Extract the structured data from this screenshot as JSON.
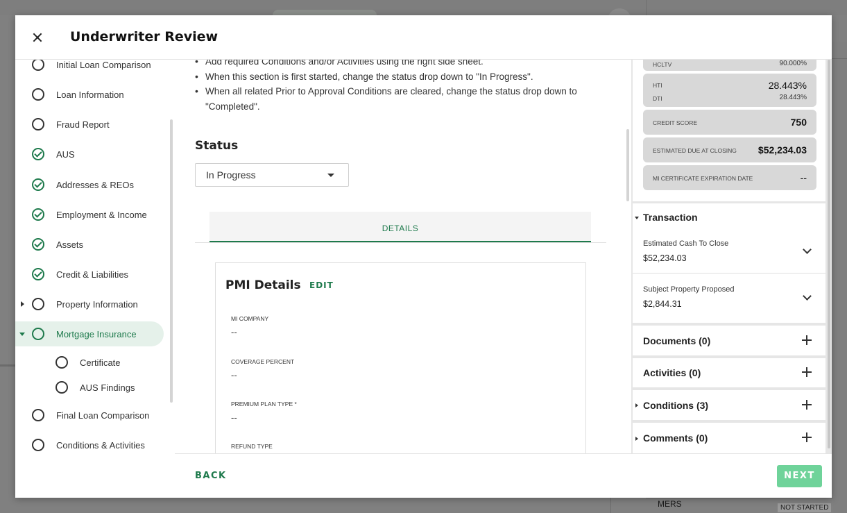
{
  "background": {
    "mers_label": "MERS",
    "not_started_badge": "NOT STARTED"
  },
  "modal": {
    "title": "Underwriter Review"
  },
  "nav": {
    "items": [
      {
        "label": "Initial Loan Comparison",
        "state": "empty"
      },
      {
        "label": "Loan Information",
        "state": "empty"
      },
      {
        "label": "Fraud Report",
        "state": "empty"
      },
      {
        "label": "AUS",
        "state": "complete"
      },
      {
        "label": "Addresses & REOs",
        "state": "complete"
      },
      {
        "label": "Employment & Income",
        "state": "complete"
      },
      {
        "label": "Assets",
        "state": "complete"
      },
      {
        "label": "Credit & Liabilities",
        "state": "complete"
      },
      {
        "label": "Property Information",
        "state": "empty"
      },
      {
        "label": "Mortgage Insurance",
        "state": "active"
      },
      {
        "label": "Certificate",
        "state": "empty"
      },
      {
        "label": "AUS Findings",
        "state": "empty"
      },
      {
        "label": "Final Loan Comparison",
        "state": "empty"
      },
      {
        "label": "Conditions & Activities",
        "state": "empty"
      }
    ]
  },
  "instructions": [
    "Add required Conditions and/or Activities using the right side sheet.",
    "When this section is first started, change the status drop down to \"In Progress\".",
    "When all related Prior to Approval Conditions are cleared, change the status drop down to \"Completed\"."
  ],
  "status": {
    "title": "Status",
    "value": "In Progress"
  },
  "tabs": {
    "details": "DETAILS"
  },
  "pmi": {
    "title": "PMI Details",
    "edit_label": "EDIT",
    "fields": [
      {
        "label": "MI COMPANY",
        "value": "--"
      },
      {
        "label": "COVERAGE PERCENT",
        "value": "--"
      },
      {
        "label": "PREMIUM PLAN TYPE *",
        "value": "--"
      },
      {
        "label": "REFUND TYPE",
        "value": ""
      }
    ]
  },
  "metrics": {
    "ltv_label": "HCLTV",
    "ltv_value": "90.000%",
    "hti_label": "HTI",
    "hti_value": "28.443%",
    "dti_label": "DTI",
    "dti_value": "28.443%",
    "credit_label": "CREDIT SCORE",
    "credit_value": "750",
    "due_label": "ESTIMATED DUE AT CLOSING",
    "due_value": "$52,234.03",
    "mi_exp_label": "MI CERTIFICATE EXPIRATION DATE",
    "mi_exp_value": "--"
  },
  "transaction": {
    "title": "Transaction",
    "cash_label": "Estimated Cash To Close",
    "cash_value": "$52,234.03",
    "proposed_label": "Subject Property Proposed",
    "proposed_value": "$2,844.31"
  },
  "sections": {
    "documents": "Documents (0)",
    "activities": "Activities (0)",
    "conditions": "Conditions (3)",
    "comments": "Comments (0)"
  },
  "footer": {
    "back": "BACK",
    "next": "NEXT"
  }
}
